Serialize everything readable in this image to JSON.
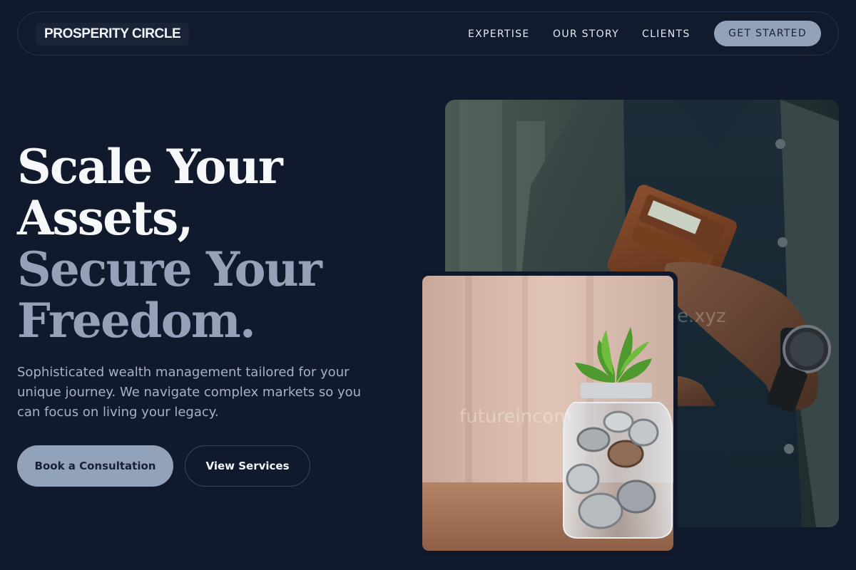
{
  "brand": {
    "name": "PROSPERITY CIRCLE"
  },
  "nav": {
    "links": [
      "EXPERTISE",
      "OUR STORY",
      "CLIENTS"
    ],
    "cta_label": "GET STARTED"
  },
  "hero": {
    "headline_lines": [
      "Scale Your",
      "Assets,",
      "Secure Your",
      "Freedom."
    ],
    "subtext": "Sophisticated wealth management tailored for your unique journey. We navigate complex markets so you can focus on living your legacy.",
    "primary_button": "Book a Consultation",
    "secondary_button": "View Services"
  },
  "images": {
    "main_watermark": "e.xyz",
    "inset_watermark": "futureincom"
  },
  "colors": {
    "background": "#111a2c",
    "accent": "#93a2bb",
    "headline_muted": "#94a1b8",
    "text_muted": "#a6b2c6"
  }
}
